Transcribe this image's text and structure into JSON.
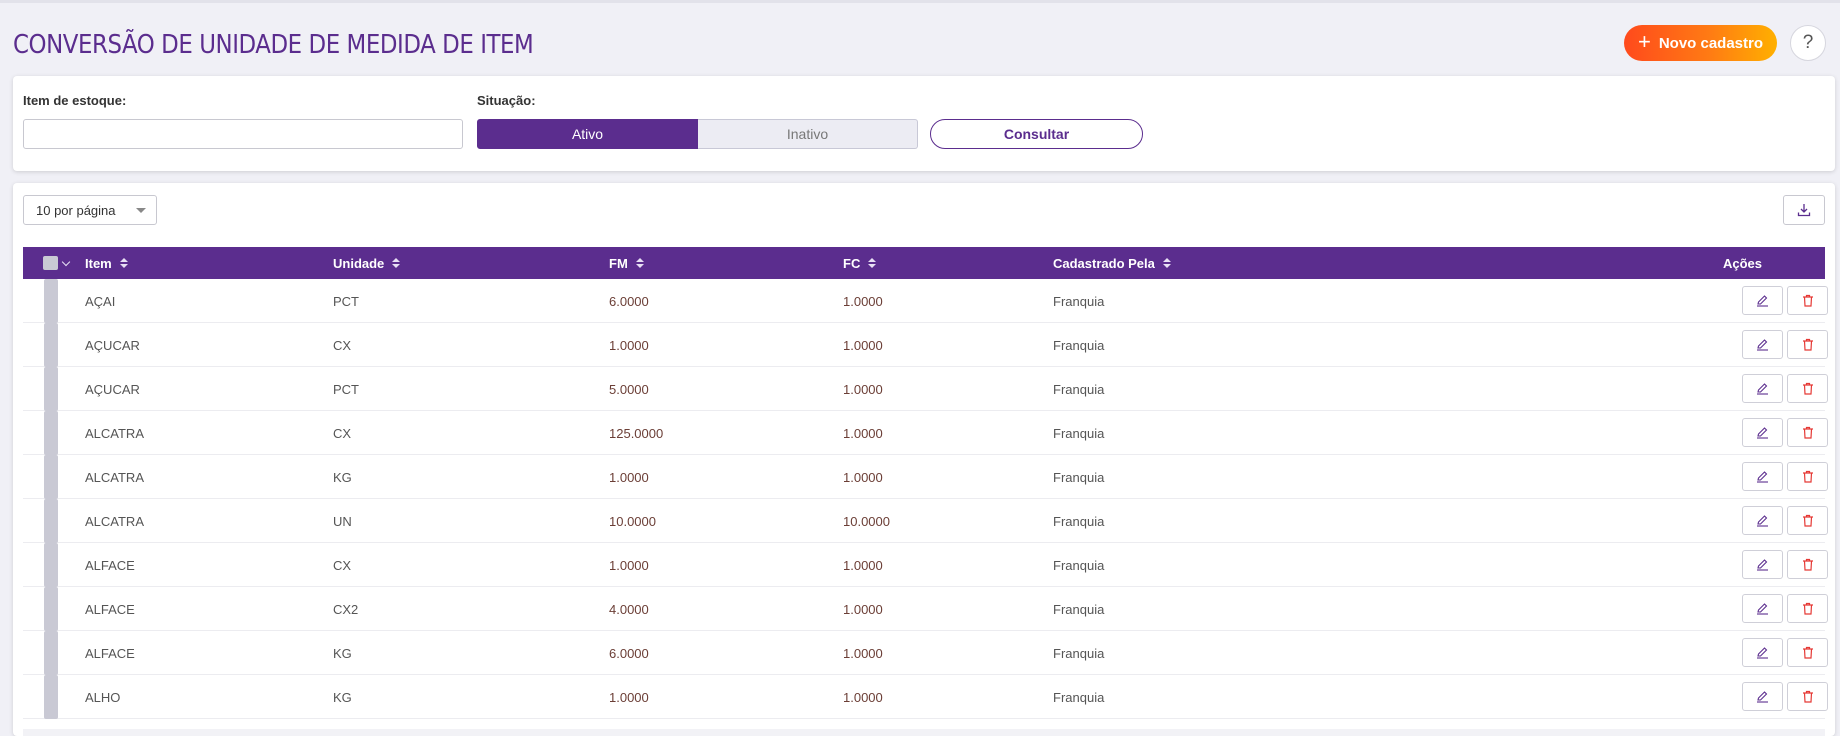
{
  "header": {
    "title": "CONVERSÃO DE UNIDADE DE MEDIDA DE ITEM",
    "new_button_label": "Novo cadastro",
    "help_label": "?"
  },
  "filters": {
    "item_label": "Item de estoque",
    "item_value": "",
    "status_label": "Situação",
    "status_options": [
      "Ativo",
      "Inativo"
    ],
    "status_selected": "Ativo",
    "search_button_label": "Consultar"
  },
  "table": {
    "per_page_label": "10 por página",
    "columns": {
      "item": "Item",
      "unit": "Unidade",
      "fm": "FM",
      "fc": "FC",
      "registered_by": "Cadastrado Pela",
      "actions": "Ações"
    },
    "rows": [
      {
        "item": "AÇAI",
        "unit": "PCT",
        "fm": "6.0000",
        "fc": "1.0000",
        "registered_by": "Franquia"
      },
      {
        "item": "AÇUCAR",
        "unit": "CX",
        "fm": "1.0000",
        "fc": "1.0000",
        "registered_by": "Franquia"
      },
      {
        "item": "AÇUCAR",
        "unit": "PCT",
        "fm": "5.0000",
        "fc": "1.0000",
        "registered_by": "Franquia"
      },
      {
        "item": "ALCATRA",
        "unit": "CX",
        "fm": "125.0000",
        "fc": "1.0000",
        "registered_by": "Franquia"
      },
      {
        "item": "ALCATRA",
        "unit": "KG",
        "fm": "1.0000",
        "fc": "1.0000",
        "registered_by": "Franquia"
      },
      {
        "item": "ALCATRA",
        "unit": "UN",
        "fm": "10.0000",
        "fc": "10.0000",
        "registered_by": "Franquia"
      },
      {
        "item": "ALFACE",
        "unit": "CX",
        "fm": "1.0000",
        "fc": "1.0000",
        "registered_by": "Franquia"
      },
      {
        "item": "ALFACE",
        "unit": "CX2",
        "fm": "4.0000",
        "fc": "1.0000",
        "registered_by": "Franquia"
      },
      {
        "item": "ALFACE",
        "unit": "KG",
        "fm": "6.0000",
        "fc": "1.0000",
        "registered_by": "Franquia"
      },
      {
        "item": "ALHO",
        "unit": "KG",
        "fm": "1.0000",
        "fc": "1.0000",
        "registered_by": "Franquia"
      }
    ]
  },
  "colors": {
    "brand_purple": "#5b2d8e",
    "accent_orange_start": "#ff4a1c",
    "accent_orange_end": "#ffb000",
    "delete_red": "#e53935"
  },
  "icons": {
    "new": "plus-icon",
    "help": "question-icon",
    "export": "download-icon",
    "edit": "pencil-icon",
    "delete": "trash-icon"
  }
}
